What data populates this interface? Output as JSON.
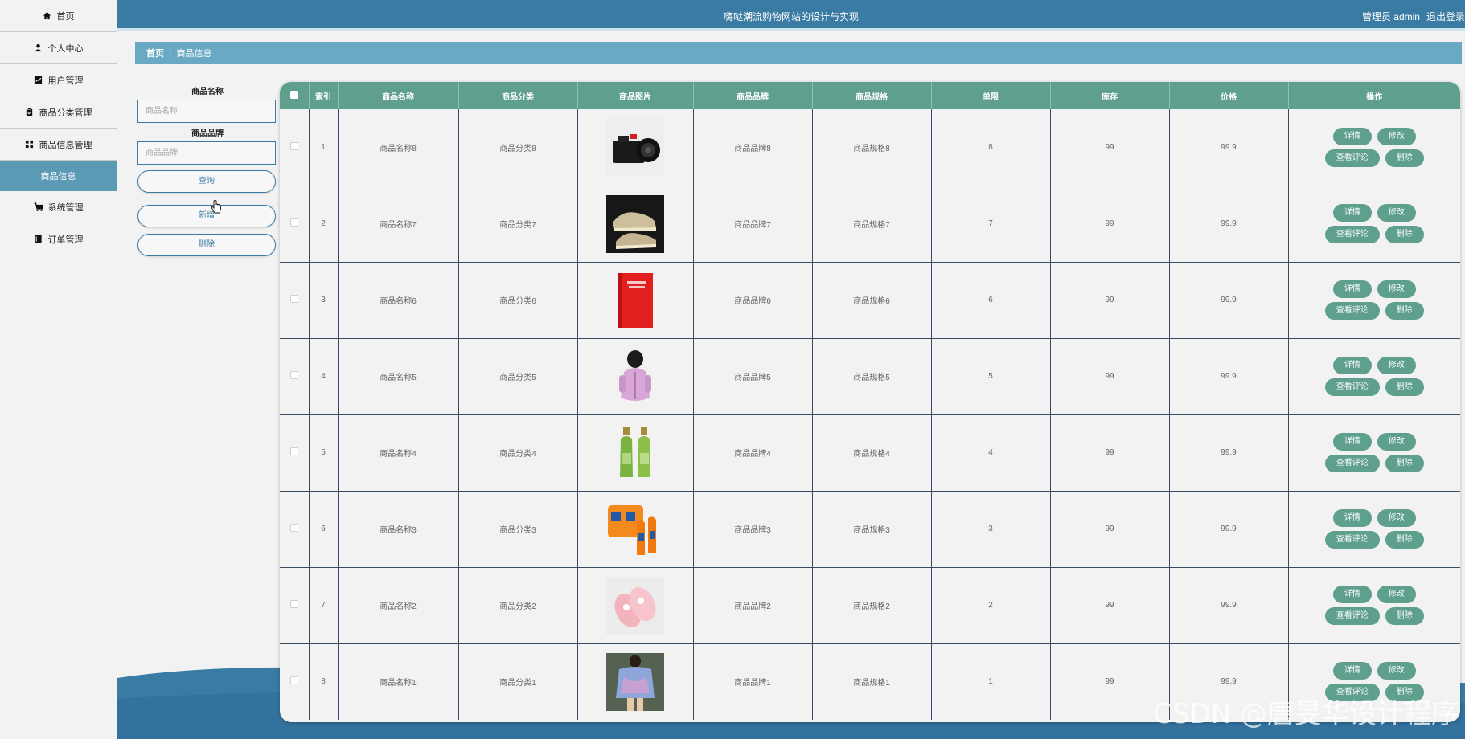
{
  "topbar": {
    "title": "嗨哒潮流购物网站的设计与实现",
    "user": "管理员 admin",
    "logout": "退出登录"
  },
  "sidebar": {
    "items": [
      {
        "label": "首页",
        "icon": "home-icon"
      },
      {
        "label": "个人中心",
        "icon": "user-icon"
      },
      {
        "label": "用户管理",
        "icon": "chart-icon"
      },
      {
        "label": "商品分类管理",
        "icon": "clipboard-icon"
      },
      {
        "label": "商品信息管理",
        "icon": "grid-icon"
      },
      {
        "label": "商品信息",
        "icon": ""
      },
      {
        "label": "系统管理",
        "icon": "cart-icon"
      },
      {
        "label": "订单管理",
        "icon": "book-icon"
      }
    ]
  },
  "breadcrumb": {
    "home": "首页",
    "current": "商品信息"
  },
  "search": {
    "name_label": "商品名称",
    "name_placeholder": "商品名称",
    "brand_label": "商品品牌",
    "brand_placeholder": "商品品牌",
    "query_button": "查询",
    "add_button": "新增",
    "delete_button": "删除"
  },
  "table": {
    "headers": [
      "",
      "索引",
      "商品名称",
      "商品分类",
      "商品图片",
      "商品品牌",
      "商品规格",
      "单限",
      "库存",
      "价格",
      "操作"
    ],
    "actions": {
      "detail": "详情",
      "edit": "修改",
      "comments": "查看评论",
      "delete": "删除"
    },
    "rows": [
      {
        "index": "1",
        "name": "商品名称8",
        "category": "商品分类8",
        "image": "camera",
        "brand": "商品品牌8",
        "spec": "商品规格8",
        "limit": "8",
        "stock": "99",
        "price": "99.9"
      },
      {
        "index": "2",
        "name": "商品名称7",
        "category": "商品分类7",
        "image": "sneakers",
        "brand": "商品品牌7",
        "spec": "商品规格7",
        "limit": "7",
        "stock": "99",
        "price": "99.9"
      },
      {
        "index": "3",
        "name": "商品名称6",
        "category": "商品分类6",
        "image": "red-book",
        "brand": "商品品牌6",
        "spec": "商品规格6",
        "limit": "6",
        "stock": "99",
        "price": "99.9"
      },
      {
        "index": "4",
        "name": "商品名称5",
        "category": "商品分类5",
        "image": "pink-jacket",
        "brand": "商品品牌5",
        "spec": "商品规格5",
        "limit": "5",
        "stock": "99",
        "price": "99.9"
      },
      {
        "index": "5",
        "name": "商品名称4",
        "category": "商品分类4",
        "image": "green-bottles",
        "brand": "商品品牌4",
        "spec": "商品规格4",
        "limit": "4",
        "stock": "99",
        "price": "99.9"
      },
      {
        "index": "6",
        "name": "商品名称3",
        "category": "商品分类3",
        "image": "orange-drinks",
        "brand": "商品品牌3",
        "spec": "商品规格3",
        "limit": "3",
        "stock": "99",
        "price": "99.9"
      },
      {
        "index": "7",
        "name": "商品名称2",
        "category": "商品分类2",
        "image": "pink-slippers",
        "brand": "商品品牌2",
        "spec": "商品规格2",
        "limit": "2",
        "stock": "99",
        "price": "99.9"
      },
      {
        "index": "8",
        "name": "商品名称1",
        "category": "商品分类1",
        "image": "tie-dye-shirt",
        "brand": "商品品牌1",
        "spec": "商品规格1",
        "limit": "1",
        "stock": "99",
        "price": "99.9"
      }
    ]
  },
  "watermark": "CSDN @唐旻华设计程序",
  "colors": {
    "primary": "#3a7ba3",
    "table_header": "#5f9f8d",
    "breadcrumb": "#6aa9c4",
    "menu_active": "#5b9ab5"
  }
}
